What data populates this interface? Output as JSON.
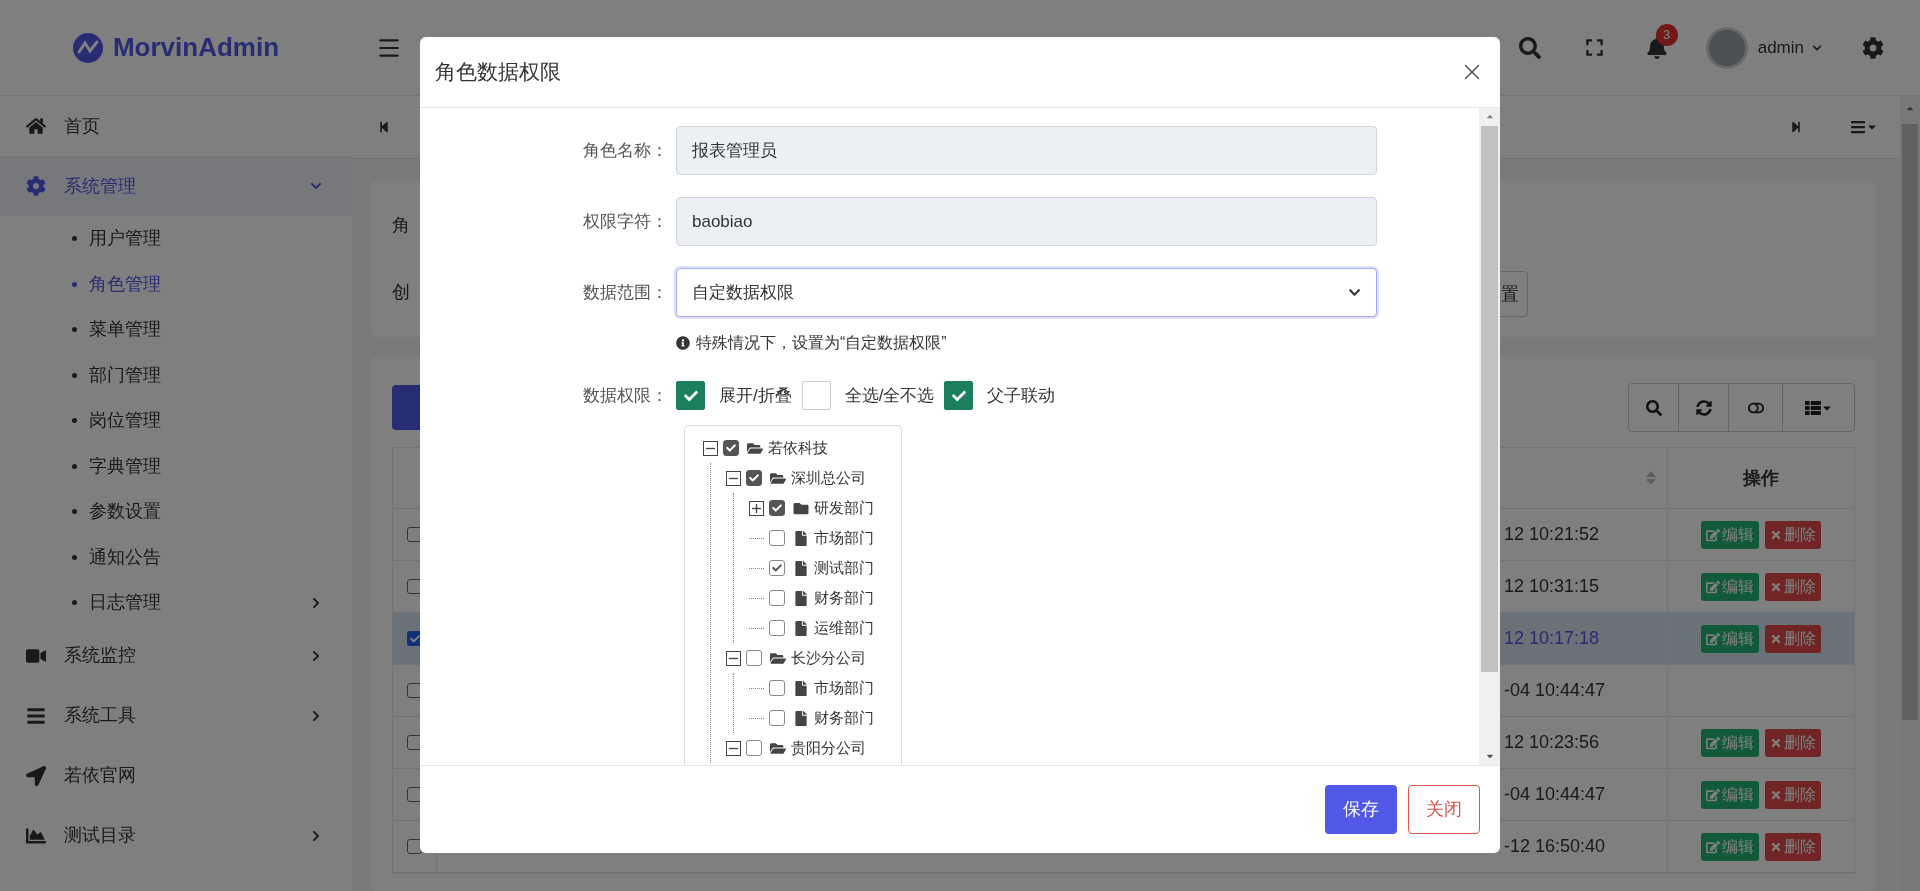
{
  "header": {
    "logo": "MorvinAdmin",
    "notification_count": "3",
    "user": "admin"
  },
  "sidebar": {
    "items": [
      {
        "label": "首页",
        "selected": false
      },
      {
        "label": "系统管理",
        "selected": true,
        "expanded": true,
        "children": [
          {
            "label": "用户管理",
            "selected": false
          },
          {
            "label": "角色管理",
            "selected": true
          },
          {
            "label": "菜单管理",
            "selected": false
          },
          {
            "label": "部门管理",
            "selected": false
          },
          {
            "label": "岗位管理",
            "selected": false
          },
          {
            "label": "字典管理",
            "selected": false
          },
          {
            "label": "参数设置",
            "selected": false
          },
          {
            "label": "通知公告",
            "selected": false
          },
          {
            "label": "日志管理",
            "selected": false,
            "expanded": false
          }
        ]
      },
      {
        "label": "系统监控",
        "selected": false,
        "expanded": false
      },
      {
        "label": "系统工具",
        "selected": false,
        "expanded": false
      },
      {
        "label": "若依官网",
        "selected": false
      },
      {
        "label": "测试目录",
        "selected": false,
        "expanded": false
      }
    ]
  },
  "search_card": {
    "texts": [
      "角",
      "创"
    ],
    "button": "置"
  },
  "table": {
    "action_header": "操作",
    "rows": [
      {
        "selected": false,
        "time": "12 10:21:52",
        "actions": [
          "编辑",
          "删除"
        ]
      },
      {
        "selected": false,
        "time": "12 10:31:15",
        "actions": [
          "编辑",
          "删除"
        ]
      },
      {
        "selected": true,
        "time": "12 10:17:18",
        "actions": [
          "编辑",
          "删除"
        ]
      },
      {
        "selected": false,
        "time": "-04 10:44:47"
      },
      {
        "selected": false,
        "time": "12 10:23:56",
        "actions": [
          "编辑",
          "删除"
        ]
      },
      {
        "selected": false,
        "time": "-04 10:44:47",
        "actions": [
          "编辑",
          "删除"
        ]
      },
      {
        "selected": false,
        "time": "-12 16:50:40",
        "actions": [
          "编辑",
          "删除"
        ]
      }
    ]
  },
  "dialog": {
    "title": "角色数据权限",
    "fields": [
      {
        "label": "角色名称：",
        "value": "报表管理员",
        "kind": "readonly"
      },
      {
        "label": "权限字符：",
        "value": "baobiao",
        "kind": "readonly"
      },
      {
        "label": "数据范围：",
        "value": "自定数据权限",
        "kind": "select",
        "hint": "特殊情况下，设置为“自定数据权限”"
      }
    ],
    "permission": {
      "label": "数据权限：",
      "options": [
        {
          "label": "展开/折叠",
          "checked": true
        },
        {
          "label": "全选/全不选",
          "checked": false
        },
        {
          "label": "父子联动",
          "checked": true
        }
      ],
      "tree": [
        {
          "label": "若依科技",
          "checked": true,
          "expanded": true,
          "children": [
            {
              "label": "深圳总公司",
              "checked": true,
              "expanded": true,
              "children": [
                {
                  "label": "研发部门",
                  "checked": true,
                  "expanded": false
                },
                {
                  "label": "市场部门",
                  "checked": false
                },
                {
                  "label": "测试部门",
                  "checked": true
                },
                {
                  "label": "财务部门",
                  "checked": false
                },
                {
                  "label": "运维部门",
                  "checked": false
                }
              ]
            },
            {
              "label": "长沙分公司",
              "checked": false,
              "expanded": true,
              "children": [
                {
                  "label": "市场部门",
                  "checked": false
                },
                {
                  "label": "财务部门",
                  "checked": false
                }
              ]
            },
            {
              "label": "贵阳分公司",
              "checked": false,
              "expanded": true
            }
          ]
        }
      ]
    },
    "buttons": [
      {
        "label": "保存",
        "kind": "primary"
      },
      {
        "label": "关闭",
        "kind": "secondary"
      }
    ]
  }
}
